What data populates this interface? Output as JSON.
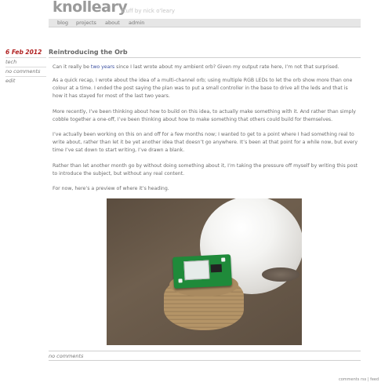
{
  "site": {
    "title": "knolleary",
    "tagline": "stuff by nick o'leary"
  },
  "nav": {
    "items": [
      {
        "label": "blog"
      },
      {
        "label": "projects"
      },
      {
        "label": "about"
      },
      {
        "label": "admin"
      }
    ]
  },
  "sidebar": {
    "date": "6 Feb 2012",
    "tag": "tech",
    "comments": "no comments",
    "edit": "edit"
  },
  "post": {
    "title": "Reintroducing the Orb",
    "p1_before": "Can it really be ",
    "p1_link": "two years",
    "p1_after": " since I last wrote about my ambient orb? Given my output rate here, I’m not that surprised.",
    "p2": "As a quick recap, I wrote about the idea of a multi-channel orb; using multiple RGB LEDs to let the orb show more than one colour at a time. I ended the post saying the plan was to put a small controller in the base to drive all the leds and that is how it has stayed for most of the last two years.",
    "p3": "More recently, I’ve been thinking about how to build on this idea, to actually make something with it. And rather than simply cobble together a one-off, I’ve been thinking about how to make something that others could build for themselves.",
    "p4": "I’ve actually been working on this on and off for a few months now; I wanted to get to a point where I had something real to write about, rather than let it be yet another idea that doesn’t go anywhere. It’s been at that point for a while now, but every time I’ve sat down to start writing, I’ve drawn a blank.",
    "p5": "Rather than let another month go by without doing something about it, I’m taking the pressure off myself by writing this post to introduce the subject, but without any real content.",
    "p6": "For now, here’s a preview of where it’s heading.",
    "footer": "no comments"
  },
  "page_footer": {
    "text": "comments rss | feed"
  },
  "colors": {
    "date": "#b02020",
    "link": "#3a4fa0",
    "nav_bg": "#e6e6e6"
  }
}
